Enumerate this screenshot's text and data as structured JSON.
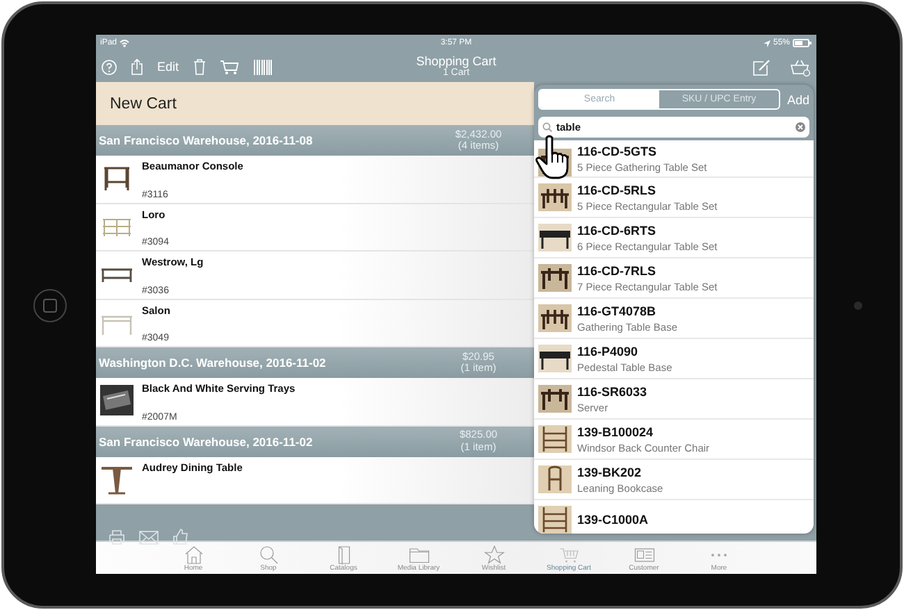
{
  "status_bar": {
    "device": "iPad",
    "time": "3:57 PM",
    "battery": "55%"
  },
  "toolbar": {
    "title": "Shopping Cart",
    "subtitle": "1 Cart",
    "edit_label": "Edit"
  },
  "cart": {
    "name": "New Cart",
    "groups": [
      {
        "warehouse": "San Francisco Warehouse, 2016-11-08",
        "total": "$2,432.00",
        "count": "(4 items)",
        "items": [
          {
            "name": "Beaumanor Console",
            "sku": "#3116"
          },
          {
            "name": "Loro",
            "sku": "#3094"
          },
          {
            "name": "Westrow, Lg",
            "sku": "#3036"
          },
          {
            "name": "Salon",
            "sku": "#3049"
          }
        ]
      },
      {
        "warehouse": "Washington D.C. Warehouse, 2016-11-02",
        "total": "$20.95",
        "count": "(1 item)",
        "items": [
          {
            "name": "Black And White Serving Trays",
            "sku": "#2007M"
          }
        ]
      },
      {
        "warehouse": "San Francisco Warehouse, 2016-11-02",
        "total": "$825.00",
        "count": "(1 item)",
        "items": [
          {
            "name": "Audrey Dining Table"
          }
        ]
      }
    ]
  },
  "search_panel": {
    "segments": [
      {
        "label": "Search",
        "selected": true
      },
      {
        "label": "SKU / UPC Entry",
        "selected": false
      }
    ],
    "add_label": "Add",
    "search": {
      "value": "table"
    },
    "results": [
      {
        "code": "116-CD-5GTS",
        "description": "5 Piece Gathering Table Set"
      },
      {
        "code": "116-CD-5RLS",
        "description": "5 Piece Rectangular Table Set"
      },
      {
        "code": "116-CD-6RTS",
        "description": "6 Piece Rectangular Table Set"
      },
      {
        "code": "116-CD-7RLS",
        "description": "7 Piece Rectangular Table Set"
      },
      {
        "code": "116-GT4078B",
        "description": "Gathering Table Base"
      },
      {
        "code": "116-P4090",
        "description": "Pedestal Table Base"
      },
      {
        "code": "116-SR6033",
        "description": "Server"
      },
      {
        "code": "139-B100024",
        "description": "Windsor Back Counter Chair"
      },
      {
        "code": "139-BK202",
        "description": "Leaning Bookcase"
      },
      {
        "code": "139-C1000A"
      }
    ]
  },
  "tab_bar": [
    {
      "label": "Home",
      "selected": false
    },
    {
      "label": "Shop",
      "selected": false
    },
    {
      "label": "Catalogs",
      "selected": false
    },
    {
      "label": "Media Library",
      "selected": false
    },
    {
      "label": "Wishlist",
      "selected": false
    },
    {
      "label": "Shopping Cart",
      "selected": true
    },
    {
      "label": "Customer",
      "selected": false
    },
    {
      "label": "More",
      "selected": false
    }
  ]
}
